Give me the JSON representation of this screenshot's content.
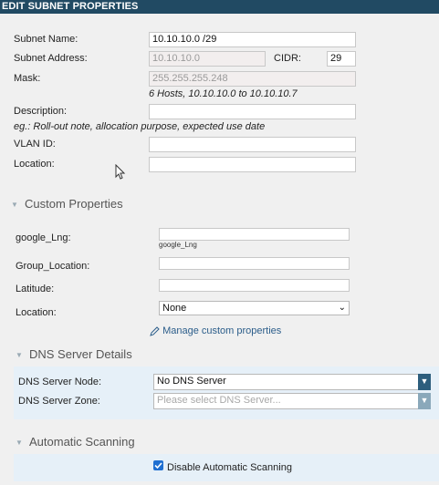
{
  "title": "EDIT SUBNET PROPERTIES",
  "subnet": {
    "name_label": "Subnet Name:",
    "name_value": "10.10.10.0 /29",
    "address_label": "Subnet Address:",
    "address_value": "10.10.10.0",
    "cidr_label": "CIDR:",
    "cidr_value": "29",
    "mask_label": "Mask:",
    "mask_value": "255.255.255.248",
    "hosts_note": "6 Hosts, 10.10.10.0 to 10.10.10.7",
    "description_label": "Description:",
    "description_value": "",
    "description_hint": "eg.: Roll-out note, allocation purpose, expected use date",
    "vlan_label": "VLAN ID:",
    "vlan_value": "",
    "location_label": "Location:",
    "location_value": ""
  },
  "custom": {
    "header": "Custom Properties",
    "google_lng_label": "google_Lng:",
    "google_lng_value": "",
    "google_lng_hint": "google_Lng",
    "group_location_label": "Group_Location:",
    "group_location_value": "",
    "latitude_label": "Latitude:",
    "latitude_value": "",
    "location_label": "Location:",
    "location_selected": "None",
    "manage_link": "Manage custom properties"
  },
  "dns": {
    "header": "DNS Server Details",
    "node_label": "DNS Server Node:",
    "node_selected": "No DNS Server",
    "zone_label": "DNS Server Zone:",
    "zone_placeholder": "Please select DNS Server..."
  },
  "scanning": {
    "header": "Automatic Scanning",
    "disable_label": "Disable Automatic Scanning",
    "disable_checked": true
  },
  "colors": {
    "titlebar": "#214a63",
    "panel": "#e6f0f8",
    "dropdown_button": "#2d5e7d"
  }
}
